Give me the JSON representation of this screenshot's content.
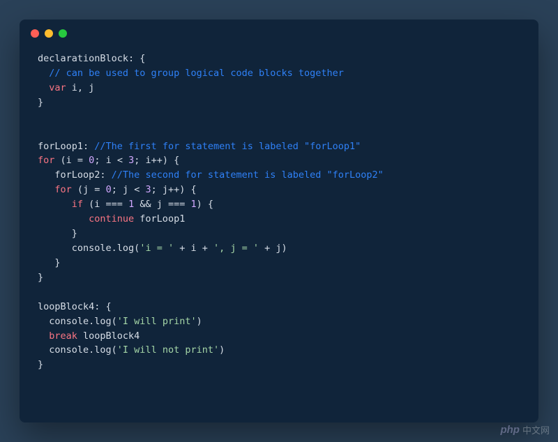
{
  "colors": {
    "page_bg": "#2a4158",
    "window_bg": "#10243a",
    "text_default": "#d6dde6",
    "comment": "#2f81f7",
    "keyword": "#f97583",
    "number": "#d2a8ff",
    "string": "#a5d6a7",
    "dot_red": "#ff5f56",
    "dot_yellow": "#ffbd2e",
    "dot_green": "#27c93f"
  },
  "code": {
    "l1_label": "declarationBlock:",
    "l1_brace": " {",
    "l2_comment": "  // can be used to group logical code blocks together",
    "l3_var": "  var",
    "l3_rest": " i, j",
    "l4": "}",
    "l7_label": "forLoop1: ",
    "l7_comment": "//The first for statement is labeled \"forLoop1\"",
    "l8_a": "for",
    "l8_b": " (i = ",
    "l8_c": "0",
    "l8_d": "; i < ",
    "l8_e": "3",
    "l8_f": "; i++) {",
    "l9_a": "   forLoop2: ",
    "l9_comment": "//The second for statement is labeled \"forLoop2\"",
    "l10_a": "   for",
    "l10_b": " (j = ",
    "l10_c": "0",
    "l10_d": "; j < ",
    "l10_e": "3",
    "l10_f": "; j++) {",
    "l11_a": "      if",
    "l11_b": " (i === ",
    "l11_c": "1",
    "l11_d": " && j === ",
    "l11_e": "1",
    "l11_f": ") {",
    "l12_a": "         continue",
    "l12_b": " forLoop1",
    "l13": "      }",
    "l14_a": "      console.log(",
    "l14_b": "'i = '",
    "l14_c": " + i + ",
    "l14_d": "', j = '",
    "l14_e": " + j)",
    "l15": "   }",
    "l16": "}",
    "l18_label": "loopBlock4:",
    "l18_brace": " {",
    "l19_a": "  console.log(",
    "l19_b": "'I will print'",
    "l19_c": ")",
    "l20_a": "  break",
    "l20_b": " loopBlock4",
    "l21_a": "  console.log(",
    "l21_b": "'I will not print'",
    "l21_c": ")",
    "l22": "}"
  },
  "watermark": {
    "logo": "php",
    "text": "中文网"
  }
}
